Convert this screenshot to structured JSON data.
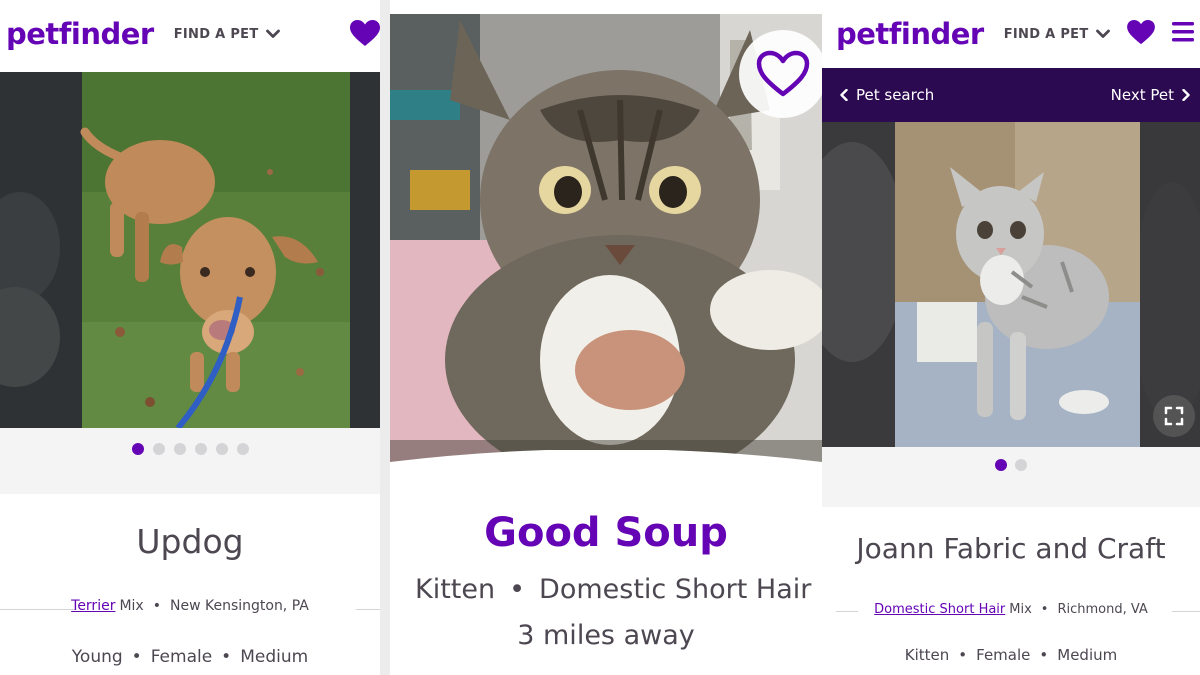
{
  "colors": {
    "brand_purple": "#6504b5",
    "nav_dark": "#2c0a52",
    "text": "#4d4751",
    "dot_inactive": "#d4d3d6"
  },
  "header": {
    "logo": "petfinder",
    "find_a_pet": "FIND A PET",
    "icons": [
      "heart-icon",
      "chevron-down-icon",
      "menu-icon"
    ]
  },
  "left_card": {
    "pet_name": "Updog",
    "breed": "Terrier",
    "breed_suffix": "Mix",
    "location": "New Kensington, PA",
    "age": "Young",
    "sex": "Female",
    "size": "Medium",
    "carousel": {
      "total": 6,
      "active": 1
    }
  },
  "middle_card": {
    "pet_name": "Good Soup",
    "age": "Kitten",
    "breed": "Domestic Short Hair",
    "distance": "3 miles away",
    "icons": [
      "heart-outline-icon"
    ]
  },
  "right_card": {
    "nav": {
      "back_label": "Pet search",
      "next_label": "Next Pet"
    },
    "pet_name": "Joann Fabric and Craft",
    "breed": "Domestic Short Hair",
    "breed_suffix": "Mix",
    "location": "Richmond, VA",
    "age": "Kitten",
    "sex": "Female",
    "size": "Medium",
    "carousel": {
      "total": 2,
      "active": 1
    },
    "icons": [
      "expand-icon"
    ]
  }
}
